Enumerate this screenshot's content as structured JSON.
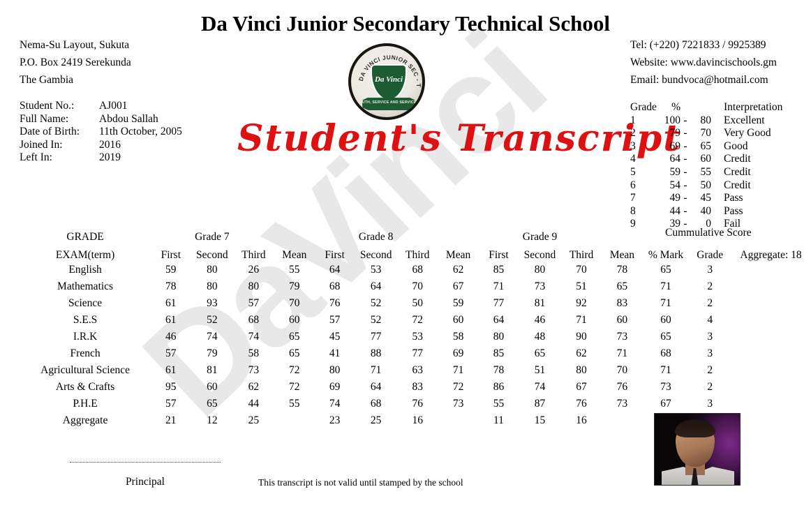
{
  "header": {
    "school_title": "Da Vinci Junior Secondary Technical School",
    "address": [
      "Nema-Su Layout, Sukuta",
      "P.O. Box 2419 Serekunda",
      "The Gambia"
    ],
    "contact": [
      "Tel: (+220) 7221833 / 9925389",
      "Website: www.davincischools.gm",
      "Email: bundvoca@hotmail.com"
    ],
    "script_title": "Student's Transcript",
    "watermark": "DaVinci"
  },
  "logo": {
    "ring_text": "DA VINCI JUNIOR SEC - TECH SCHOOL",
    "shield_mark": "Da Vinci",
    "ribbon_text": "TRUTH, SERVICE AND SERVICE"
  },
  "student": {
    "rows": [
      {
        "label": "Student No.:",
        "value": "AJ001"
      },
      {
        "label": "Full Name:",
        "value": "Abdou Sallah"
      },
      {
        "label": "Date of Birth:",
        "value": "11th October, 2005"
      },
      {
        "label": "Joined In:",
        "value": "2016"
      },
      {
        "label": "Left In:",
        "value": "2019"
      }
    ]
  },
  "grade_key": {
    "headers": {
      "grade": "Grade",
      "percent": "%",
      "interpretation": "Interpretation"
    },
    "cummulative_label": "Cummulative Score",
    "rows": [
      {
        "grade": "1",
        "high": "100",
        "dash": "-",
        "low": "80",
        "interpretation": "Excellent"
      },
      {
        "grade": "2",
        "high": "79",
        "dash": "-",
        "low": "70",
        "interpretation": "Very Good"
      },
      {
        "grade": "3",
        "high": "69",
        "dash": "-",
        "low": "65",
        "interpretation": "Good"
      },
      {
        "grade": "4",
        "high": "64",
        "dash": "-",
        "low": "60",
        "interpretation": "Credit"
      },
      {
        "grade": "5",
        "high": "59",
        "dash": "-",
        "low": "55",
        "interpretation": "Credit"
      },
      {
        "grade": "6",
        "high": "54",
        "dash": "-",
        "low": "50",
        "interpretation": "Credit"
      },
      {
        "grade": "7",
        "high": "49",
        "dash": "-",
        "low": "45",
        "interpretation": "Pass"
      },
      {
        "grade": "8",
        "high": "44",
        "dash": "-",
        "low": "40",
        "interpretation": "Pass"
      },
      {
        "grade": "9",
        "high": "39",
        "dash": "-",
        "low": "0",
        "interpretation": "Fail"
      }
    ]
  },
  "transcript": {
    "group_header": {
      "grade_label": "GRADE",
      "grade7": "Grade 7",
      "grade8": "Grade 8",
      "grade9": "Grade 9"
    },
    "column_header": {
      "exam": "EXAM(term)",
      "g7_first": "First",
      "g7_second": "Second",
      "g7_third": "Third",
      "g7_mean": "Mean",
      "g8_first": "First",
      "g8_second": "Second",
      "g8_third": "Third",
      "g8_mean": "Mean",
      "g9_first": "First",
      "g9_second": "Second",
      "g9_third": "Third",
      "g9_mean": "Mean",
      "pct_mark": "% Mark",
      "grade": "Grade",
      "aggregate": "Aggregate: 18"
    },
    "rows": [
      {
        "subject": "English",
        "g7f": "59",
        "g7s": "80",
        "g7t": "26",
        "g7m": "55",
        "g8f": "64",
        "g8s": "53",
        "g8t": "68",
        "g8m": "62",
        "g9f": "85",
        "g9s": "80",
        "g9t": "70",
        "g9m": "78",
        "pct": "65",
        "grade": "3"
      },
      {
        "subject": "Mathematics",
        "g7f": "78",
        "g7s": "80",
        "g7t": "80",
        "g7m": "79",
        "g8f": "68",
        "g8s": "64",
        "g8t": "70",
        "g8m": "67",
        "g9f": "71",
        "g9s": "73",
        "g9t": "51",
        "g9m": "65",
        "pct": "71",
        "grade": "2"
      },
      {
        "subject": "Science",
        "g7f": "61",
        "g7s": "93",
        "g7t": "57",
        "g7m": "70",
        "g8f": "76",
        "g8s": "52",
        "g8t": "50",
        "g8m": "59",
        "g9f": "77",
        "g9s": "81",
        "g9t": "92",
        "g9m": "83",
        "pct": "71",
        "grade": "2"
      },
      {
        "subject": "S.E.S",
        "g7f": "61",
        "g7s": "52",
        "g7t": "68",
        "g7m": "60",
        "g8f": "57",
        "g8s": "52",
        "g8t": "72",
        "g8m": "60",
        "g9f": "64",
        "g9s": "46",
        "g9t": "71",
        "g9m": "60",
        "pct": "60",
        "grade": "4"
      },
      {
        "subject": "I.R.K",
        "g7f": "46",
        "g7s": "74",
        "g7t": "74",
        "g7m": "65",
        "g8f": "45",
        "g8s": "77",
        "g8t": "53",
        "g8m": "58",
        "g9f": "80",
        "g9s": "48",
        "g9t": "90",
        "g9m": "73",
        "pct": "65",
        "grade": "3"
      },
      {
        "subject": "French",
        "g7f": "57",
        "g7s": "79",
        "g7t": "58",
        "g7m": "65",
        "g8f": "41",
        "g8s": "88",
        "g8t": "77",
        "g8m": "69",
        "g9f": "85",
        "g9s": "65",
        "g9t": "62",
        "g9m": "71",
        "pct": "68",
        "grade": "3"
      },
      {
        "subject": "Agricultural Science",
        "g7f": "61",
        "g7s": "81",
        "g7t": "73",
        "g7m": "72",
        "g8f": "80",
        "g8s": "71",
        "g8t": "63",
        "g8m": "71",
        "g9f": "78",
        "g9s": "51",
        "g9t": "80",
        "g9m": "70",
        "pct": "71",
        "grade": "2"
      },
      {
        "subject": "Arts & Crafts",
        "g7f": "95",
        "g7s": "60",
        "g7t": "62",
        "g7m": "72",
        "g8f": "69",
        "g8s": "64",
        "g8t": "83",
        "g8m": "72",
        "g9f": "86",
        "g9s": "74",
        "g9t": "67",
        "g9m": "76",
        "pct": "73",
        "grade": "2"
      },
      {
        "subject": "P.H.E",
        "g7f": "57",
        "g7s": "65",
        "g7t": "44",
        "g7m": "55",
        "g8f": "74",
        "g8s": "68",
        "g8t": "76",
        "g8m": "73",
        "g9f": "55",
        "g9s": "87",
        "g9t": "76",
        "g9m": "73",
        "pct": "67",
        "grade": "3"
      },
      {
        "subject": "Aggregate",
        "g7f": "21",
        "g7s": "12",
        "g7t": "25",
        "g7m": "",
        "g8f": "23",
        "g8s": "25",
        "g8t": "16",
        "g8m": "",
        "g9f": "11",
        "g9s": "15",
        "g9t": "16",
        "g9m": "",
        "pct": "",
        "grade": ""
      }
    ]
  },
  "footer": {
    "principal_label": "Principal",
    "note": "This transcript is not valid until stamped by the school"
  },
  "colors": {
    "script_red": "#dd1111",
    "shield_green": "#1d5c33",
    "watermark_gray": "#e8e8e8"
  }
}
